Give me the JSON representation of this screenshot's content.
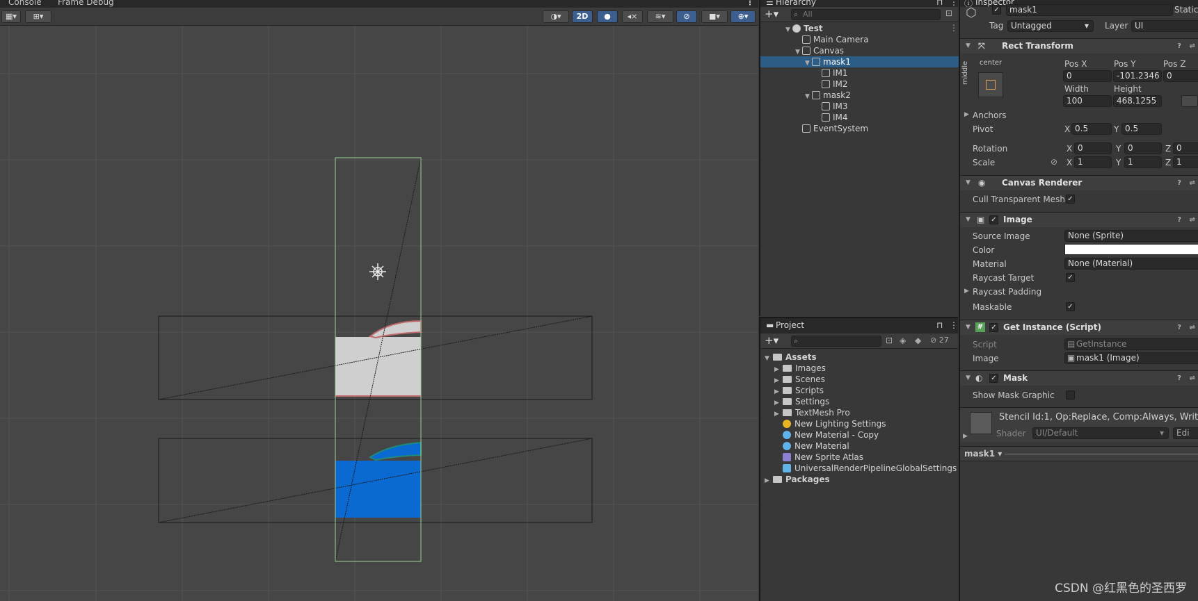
{
  "scene_view": {
    "tabs": [
      "Console",
      "Frame Debug"
    ],
    "toolbar": {
      "mode_2d": "2D"
    },
    "colors": {
      "mask_white": "#cfcfcf",
      "mask_blue": "#0a6ad1",
      "rect_outline": "#9ad49a"
    }
  },
  "hierarchy": {
    "title": "Hierarchy",
    "search_placeholder": "All",
    "items": [
      {
        "label": "Test",
        "depth": 0,
        "expanded": true,
        "selected": false
      },
      {
        "label": "Main Camera",
        "depth": 1,
        "expanded": null,
        "selected": false
      },
      {
        "label": "Canvas",
        "depth": 1,
        "expanded": true,
        "selected": false
      },
      {
        "label": "mask1",
        "depth": 2,
        "expanded": true,
        "selected": true
      },
      {
        "label": "IM1",
        "depth": 3,
        "expanded": null,
        "selected": false
      },
      {
        "label": "IM2",
        "depth": 3,
        "expanded": null,
        "selected": false
      },
      {
        "label": "mask2",
        "depth": 2,
        "expanded": true,
        "selected": false
      },
      {
        "label": "IM3",
        "depth": 3,
        "expanded": null,
        "selected": false
      },
      {
        "label": "IM4",
        "depth": 3,
        "expanded": null,
        "selected": false
      },
      {
        "label": "EventSystem",
        "depth": 1,
        "expanded": null,
        "selected": false
      }
    ]
  },
  "project": {
    "title": "Project",
    "hidden_count": "27",
    "items": [
      {
        "label": "Assets",
        "kind": "folder-root"
      },
      {
        "label": "Images",
        "kind": "folder"
      },
      {
        "label": "Scenes",
        "kind": "folder"
      },
      {
        "label": "Scripts",
        "kind": "folder"
      },
      {
        "label": "Settings",
        "kind": "folder"
      },
      {
        "label": "TextMesh Pro",
        "kind": "folder"
      },
      {
        "label": "New Lighting Settings",
        "kind": "lighting"
      },
      {
        "label": "New Material - Copy",
        "kind": "material"
      },
      {
        "label": "New Material",
        "kind": "material"
      },
      {
        "label": "New Sprite Atlas",
        "kind": "atlas"
      },
      {
        "label": "UniversalRenderPipelineGlobalSettings",
        "kind": "settings"
      },
      {
        "label": "Packages",
        "kind": "folder-root"
      }
    ]
  },
  "inspector": {
    "title": "Inspector",
    "object_name": "mask1",
    "static_label": "Static",
    "tag_label": "Tag",
    "tag_value": "Untagged",
    "layer_label": "Layer",
    "layer_value": "UI",
    "rect_transform": {
      "title": "Rect Transform",
      "anchor_h": "center",
      "anchor_v": "middle",
      "pos_x_label": "Pos X",
      "pos_y_label": "Pos Y",
      "pos_z_label": "Pos Z",
      "pos_x": "0",
      "pos_y": "-101.2346",
      "pos_z": "0",
      "width_label": "Width",
      "height_label": "Height",
      "width": "100",
      "height": "468.1255",
      "anchors_label": "Anchors",
      "pivot_label": "Pivot",
      "pivot_x": "0.5",
      "pivot_y": "0.5",
      "rotation_label": "Rotation",
      "rot_x": "0",
      "rot_y": "0",
      "rot_z": "0",
      "scale_label": "Scale",
      "scale_x": "1",
      "scale_y": "1",
      "scale_z": "1",
      "x": "X",
      "y": "Y",
      "z": "Z"
    },
    "canvas_renderer": {
      "title": "Canvas Renderer",
      "cull_label": "Cull Transparent Mesh"
    },
    "image": {
      "title": "Image",
      "source_label": "Source Image",
      "source_value": "None (Sprite)",
      "color_label": "Color",
      "material_label": "Material",
      "material_value": "None (Material)",
      "raycast_label": "Raycast Target",
      "padding_label": "Raycast Padding",
      "maskable_label": "Maskable"
    },
    "get_instance": {
      "title": "Get Instance (Script)",
      "script_label": "Script",
      "script_value": "GetInstance",
      "image_label": "Image",
      "image_value": "mask1 (Image)"
    },
    "mask": {
      "title": "Mask",
      "show_label": "Show Mask Graphic"
    },
    "material_preview": {
      "stencil": "Stencil Id:1, Op:Replace, Comp:Always, Writ",
      "shader_label": "Shader",
      "shader_value": "UI/Default",
      "edit": "Edi"
    },
    "footer_label": "mask1"
  },
  "watermark": "CSDN @红黑色的圣西罗"
}
